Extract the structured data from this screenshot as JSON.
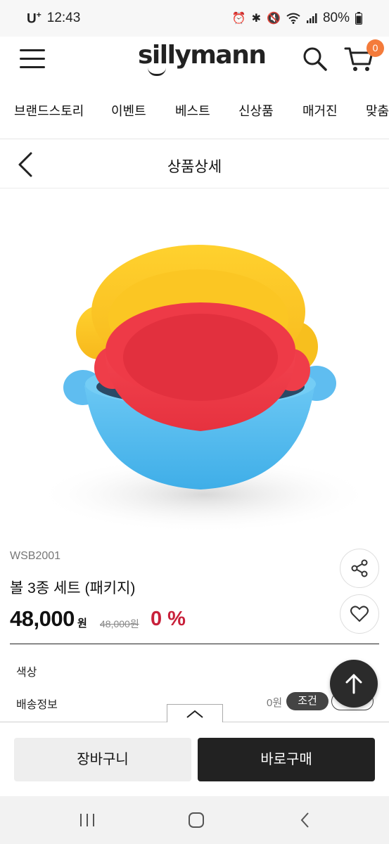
{
  "status_bar": {
    "carrier": "U",
    "carrier_plus": "+",
    "time": "12:43",
    "battery": "80%"
  },
  "header": {
    "logo": "sillymann",
    "cart_count": "0"
  },
  "category_nav": {
    "items": [
      "브랜드스토리",
      "이벤트",
      "베스트",
      "신상품",
      "매거진",
      "맞춤/"
    ]
  },
  "title_bar": {
    "title": "상품상세"
  },
  "product": {
    "sku": "WSB2001",
    "name": "볼 3종 세트 (패키지)",
    "price": "48,000",
    "price_unit": "원",
    "original_price": "48,000원",
    "discount": "0 %"
  },
  "options": {
    "color_label": "색상",
    "shipping_label": "배송정보",
    "shipping_fee": "0원",
    "condition_badge": "조건"
  },
  "actions": {
    "cart": "장바구니",
    "buy_now": "바로구매"
  },
  "colors": {
    "accent_badge": "#f47b3b",
    "discount": "#c8203a",
    "primary_button": "#222222"
  }
}
